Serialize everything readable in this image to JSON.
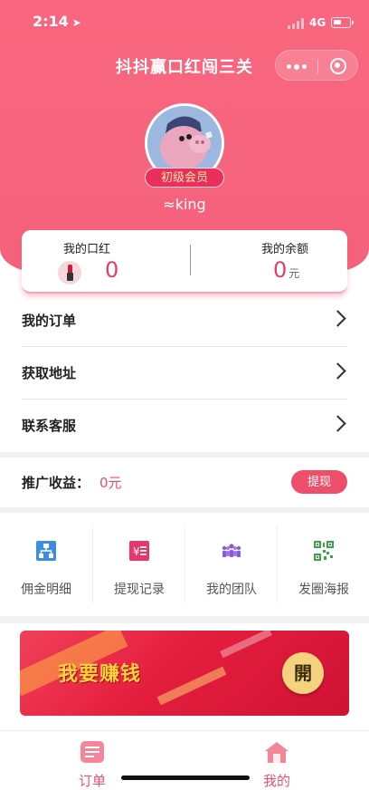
{
  "status_bar": {
    "time": "2:14",
    "location_glyph": "➤",
    "network": "4G"
  },
  "nav": {
    "title": "抖抖赢口红闯三关"
  },
  "profile": {
    "level": "初级会员",
    "username": "≈king"
  },
  "stats": {
    "lipstick_label": "我的口红",
    "lipstick_count": "0",
    "balance_label": "我的余额",
    "balance_value": "0",
    "balance_unit": "元"
  },
  "menu": [
    {
      "label": "我的订单"
    },
    {
      "label": "获取地址"
    },
    {
      "label": "联系客服"
    }
  ],
  "promotion": {
    "label": "推广收益：",
    "value": "0元",
    "withdraw_label": "提现"
  },
  "grid": [
    {
      "label": "佣金明细",
      "icon": "commission-icon",
      "color": "#3b8de0"
    },
    {
      "label": "提现记录",
      "icon": "withdraw-record-icon",
      "color": "#e8356a"
    },
    {
      "label": "我的团队",
      "icon": "team-icon",
      "color": "#8a5bd6"
    },
    {
      "label": "发圈海报",
      "icon": "qrcode-icon",
      "color": "#3aa547"
    }
  ],
  "banner": {
    "text": "我要赚钱",
    "open_label": "開"
  },
  "tabbar": [
    {
      "label": "订单",
      "icon": "order-icon"
    },
    {
      "label": "我的",
      "icon": "home-icon"
    }
  ],
  "colors": {
    "primary": "#f5617b",
    "accent": "#e23e66",
    "button": "#ed4f6b",
    "banner": "#e41e3d",
    "gold": "#ffd43a"
  }
}
